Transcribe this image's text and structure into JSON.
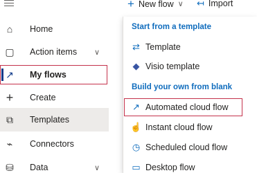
{
  "nav": {
    "items": [
      {
        "label": "Home",
        "icon": "home-icon",
        "glyph": "⌂"
      },
      {
        "label": "Action items",
        "icon": "clipboard-icon",
        "glyph": "▢",
        "chevron": "∨"
      },
      {
        "label": "My flows",
        "icon": "flow-icon",
        "glyph": "↗"
      },
      {
        "label": "Create",
        "icon": "plus-icon",
        "glyph": "+"
      },
      {
        "label": "Templates",
        "icon": "templates-icon",
        "glyph": "⧉"
      },
      {
        "label": "Connectors",
        "icon": "connector-icon",
        "glyph": "⌁"
      },
      {
        "label": "Data",
        "icon": "database-icon",
        "glyph": "⛁",
        "chevron": "∨"
      }
    ]
  },
  "toolbar": {
    "new_flow_label": "New flow",
    "new_flow_chevron": "∨",
    "import_label": "Import"
  },
  "menu": {
    "section_template": "Start from a template",
    "section_blank": "Build your own from blank",
    "items": [
      {
        "label": "Template",
        "icon": "template-icon",
        "glyph": "⇄"
      },
      {
        "label": "Visio template",
        "icon": "visio-icon",
        "glyph": "◆"
      },
      {
        "label": "Automated cloud flow",
        "icon": "automated-flow-icon",
        "glyph": "↗"
      },
      {
        "label": "Instant cloud flow",
        "icon": "touch-icon",
        "glyph": "☝"
      },
      {
        "label": "Scheduled cloud flow",
        "icon": "clock-icon",
        "glyph": "◷"
      },
      {
        "label": "Desktop flow",
        "icon": "desktop-icon",
        "glyph": "▭"
      }
    ]
  },
  "colors": {
    "accent": "#0f6cbd",
    "highlight_border": "#c4314b",
    "selected_bg": "#edebe9"
  }
}
